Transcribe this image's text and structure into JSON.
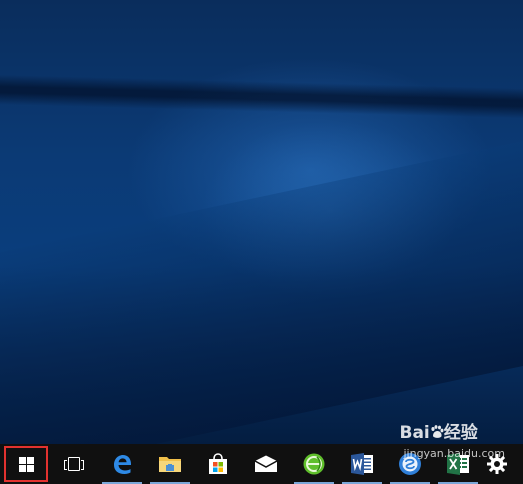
{
  "desktop": {
    "wallpaper_colors": {
      "top": "#0a2d5c",
      "middle": "#0b3a75",
      "bottom": "#041d40"
    }
  },
  "taskbar": {
    "background": "#101010",
    "highlight_color": "#e3322f",
    "items": [
      {
        "name": "start-button",
        "icon": "windows-logo-icon",
        "highlighted": true
      },
      {
        "name": "task-view-button",
        "icon": "task-view-icon"
      },
      {
        "name": "edge-button",
        "icon": "edge-icon",
        "active": true
      },
      {
        "name": "file-explorer-button",
        "icon": "folder-icon",
        "active": true
      },
      {
        "name": "store-button",
        "icon": "store-bag-icon"
      },
      {
        "name": "mail-button",
        "icon": "envelope-icon"
      },
      {
        "name": "browser-button",
        "icon": "green-globe-icon",
        "active": true
      },
      {
        "name": "word-button",
        "icon": "word-icon",
        "active": true
      },
      {
        "name": "sogou-button",
        "icon": "blue-circle-icon",
        "active": true
      },
      {
        "name": "excel-button",
        "icon": "excel-icon",
        "active": true
      },
      {
        "name": "settings-button",
        "icon": "gear-icon"
      }
    ]
  },
  "watermark": {
    "brand_prefix": "Bai",
    "brand_suffix": "经验",
    "url": "jingyan.baidu.com"
  }
}
